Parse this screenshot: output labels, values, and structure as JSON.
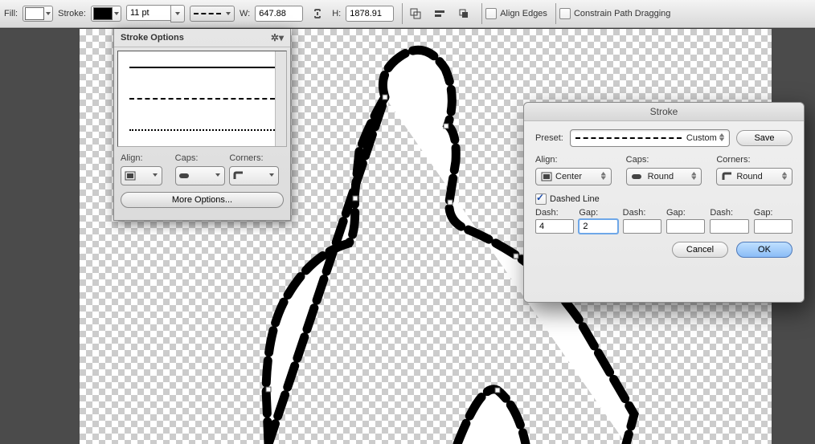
{
  "optbar": {
    "fill_label": "Fill:",
    "stroke_label": "Stroke:",
    "stroke_width": "11 pt",
    "w_label": "W:",
    "w_value": "647.88",
    "h_label": "H:",
    "h_value": "1878.91",
    "align_edges_label": "Align Edges",
    "align_edges_checked": false,
    "constrain_label": "Constrain Path Dragging",
    "constrain_checked": false
  },
  "flyout": {
    "title": "Stroke Options",
    "align_label": "Align:",
    "caps_label": "Caps:",
    "corners_label": "Corners:",
    "more_label": "More Options..."
  },
  "dialog": {
    "title": "Stroke",
    "preset_label": "Preset:",
    "preset_value": "Custom",
    "save_label": "Save",
    "align_label": "Align:",
    "align_value": "Center",
    "caps_label": "Caps:",
    "caps_value": "Round",
    "corners_label": "Corners:",
    "corners_value": "Round",
    "dashed_label": "Dashed Line",
    "dashed_checked": true,
    "dash_labels": [
      "Dash:",
      "Gap:",
      "Dash:",
      "Gap:",
      "Dash:",
      "Gap:"
    ],
    "dash_values": [
      "4",
      "2",
      "",
      "",
      "",
      ""
    ],
    "cancel_label": "Cancel",
    "ok_label": "OK"
  }
}
